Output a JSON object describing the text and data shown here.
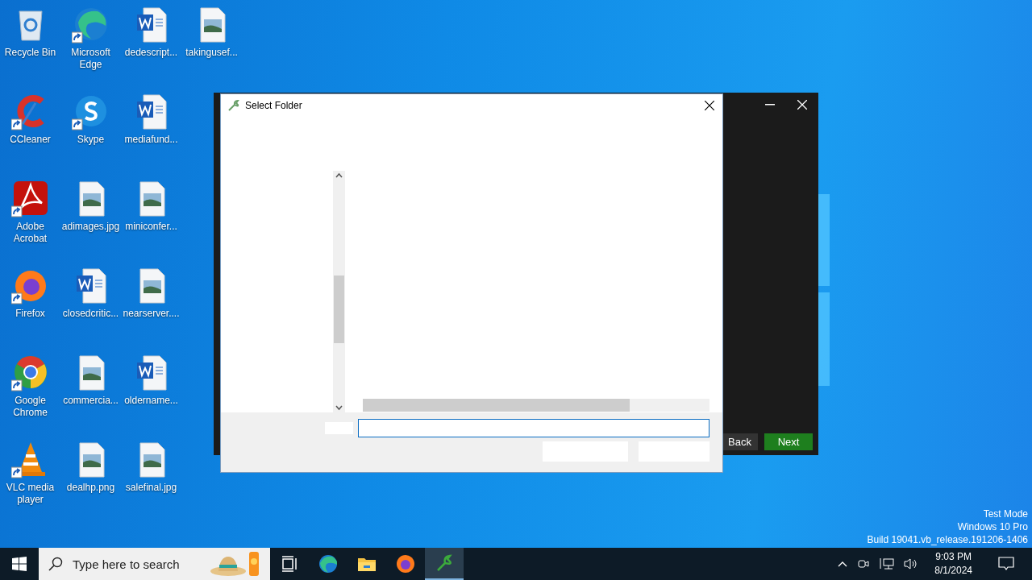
{
  "desktop": {
    "icons": [
      {
        "label": "Recycle Bin",
        "kind": "recycle",
        "shortcut": false
      },
      {
        "label": "CCleaner",
        "kind": "ccleaner",
        "shortcut": true
      },
      {
        "label": "Adobe Acrobat",
        "kind": "acrobat",
        "shortcut": true
      },
      {
        "label": "Firefox",
        "kind": "firefox",
        "shortcut": true
      },
      {
        "label": "Google Chrome",
        "kind": "chrome",
        "shortcut": true
      },
      {
        "label": "VLC media player",
        "kind": "vlc",
        "shortcut": true
      },
      {
        "label": "Microsoft Edge",
        "kind": "edge",
        "shortcut": true
      },
      {
        "label": "Skype",
        "kind": "skype",
        "shortcut": true
      },
      {
        "label": "adimages.jpg",
        "kind": "image",
        "shortcut": false
      },
      {
        "label": "closedcritic...",
        "kind": "word",
        "shortcut": false
      },
      {
        "label": "commercia...",
        "kind": "image",
        "shortcut": false
      },
      {
        "label": "dealhp.png",
        "kind": "image",
        "shortcut": false
      },
      {
        "label": "dedescript...",
        "kind": "word",
        "shortcut": false
      },
      {
        "label": "mediafund...",
        "kind": "word",
        "shortcut": false
      },
      {
        "label": "miniconfer...",
        "kind": "image",
        "shortcut": false
      },
      {
        "label": "nearserver....",
        "kind": "image",
        "shortcut": false
      },
      {
        "label": "oldername...",
        "kind": "word",
        "shortcut": false
      },
      {
        "label": "salefinal.jpg",
        "kind": "image",
        "shortcut": false
      },
      {
        "label": "takingusef...",
        "kind": "image",
        "shortcut": false
      }
    ],
    "system_text": [
      "Test Mode",
      "Windows 10 Pro",
      "Build 19041.vb_release.191206-1406"
    ]
  },
  "installer_window": {
    "buttons": [
      {
        "label": "Back",
        "kind": "secondary"
      },
      {
        "label": "Next",
        "kind": "primary"
      }
    ]
  },
  "dialog": {
    "title": "Select Folder"
  },
  "taskbar": {
    "search": {
      "placeholder": "Type here to search"
    },
    "apps": [
      {
        "kind": "taskview",
        "selected": false
      },
      {
        "kind": "edge",
        "selected": false
      },
      {
        "kind": "explorer",
        "selected": false
      },
      {
        "kind": "firefox",
        "selected": false
      },
      {
        "kind": "installer",
        "selected": true
      }
    ],
    "time": "9:03 PM",
    "date": "8/1/2024"
  }
}
